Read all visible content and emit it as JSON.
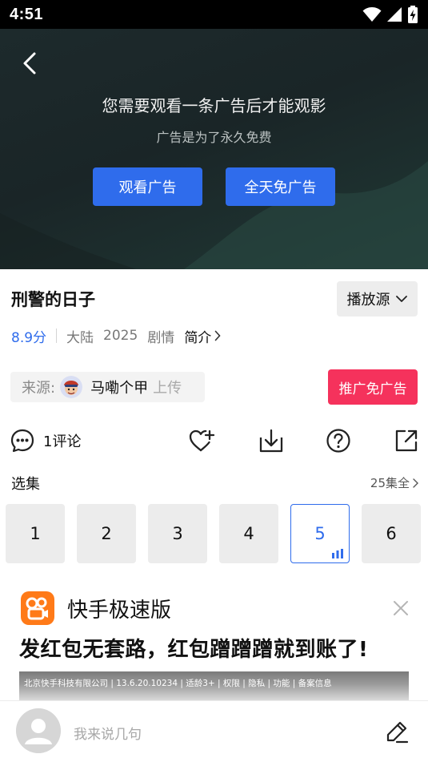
{
  "status_bar": {
    "time": "4:51",
    "icons": [
      "wifi-icon",
      "signal-icon",
      "battery-charging-icon"
    ]
  },
  "player": {
    "back_icon": "chevron-left-icon",
    "ad_title": "您需要观看一条广告后才能观影",
    "ad_subtitle": "广告是为了永久免费",
    "watch_ad_label": "观看广告",
    "allday_no_ad_label": "全天免广告"
  },
  "show": {
    "title": "刑警的日子",
    "source_label": "播放源",
    "score": "8.9分",
    "region": "大陆",
    "year": "2025",
    "genre": "剧情",
    "intro_label": "简介"
  },
  "uploader": {
    "source_label": "来源:",
    "name": "马嘞个甲",
    "uploaded_label": "上传"
  },
  "promo_button": "推广免广告",
  "actions": {
    "comment_count": "1评论",
    "icons": [
      "comment-icon",
      "favorite-add-icon",
      "download-icon",
      "help-icon",
      "share-icon"
    ]
  },
  "episodes": {
    "header": "选集",
    "all_label": "25集全",
    "items": [
      "1",
      "2",
      "3",
      "4",
      "5",
      "6"
    ],
    "active_index": 4
  },
  "ad_card": {
    "app_name": "快手极速版",
    "headline": "发红包无套路，红包蹭蹭蹭就到账了!",
    "footer_text": "北京快手科技有限公司 | 13.6.20.10234 | 适龄3+ | 权限 | 隐私 | 功能 | 备案信息"
  },
  "comment_bar": {
    "placeholder": "我来说几句"
  },
  "colors": {
    "accent_blue": "#2f6cec",
    "promo_red": "#f5325c",
    "player_bg": "#1d2a2c"
  }
}
